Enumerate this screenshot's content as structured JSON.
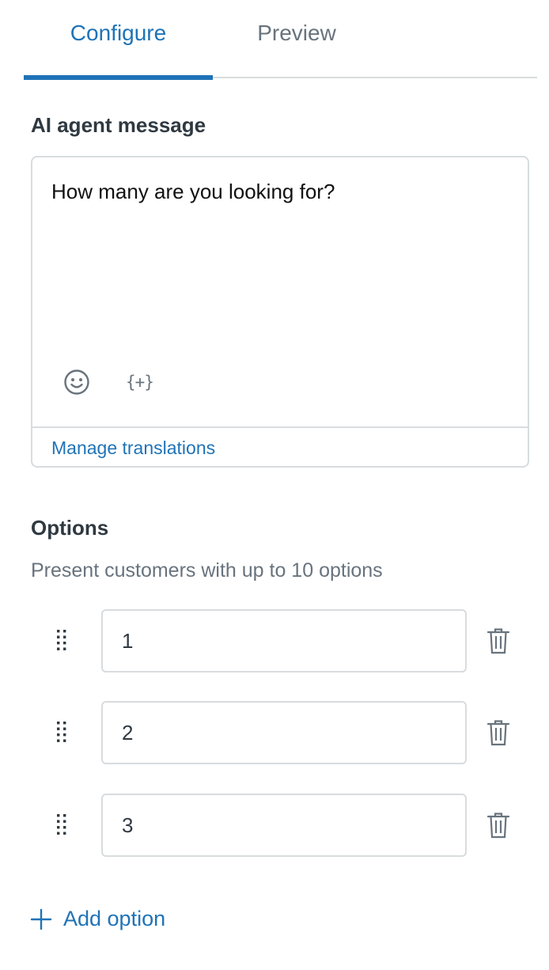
{
  "tabs": [
    {
      "label": "Configure",
      "active": true
    },
    {
      "label": "Preview",
      "active": false
    }
  ],
  "agent_message": {
    "heading": "AI agent message",
    "text": "How many are you looking for?",
    "tools": {
      "emoji_icon": "smiley-icon",
      "variable_label": "{+}"
    },
    "manage_translations": "Manage translations"
  },
  "options": {
    "heading": "Options",
    "description": "Present customers with up to 10 options",
    "items": [
      {
        "value": "1"
      },
      {
        "value": "2"
      },
      {
        "value": "3"
      }
    ],
    "add_label": "Add option"
  },
  "colors": {
    "accent": "#1f73b7",
    "text": "#2f3941",
    "muted": "#68737d",
    "border": "#d8dcde"
  }
}
